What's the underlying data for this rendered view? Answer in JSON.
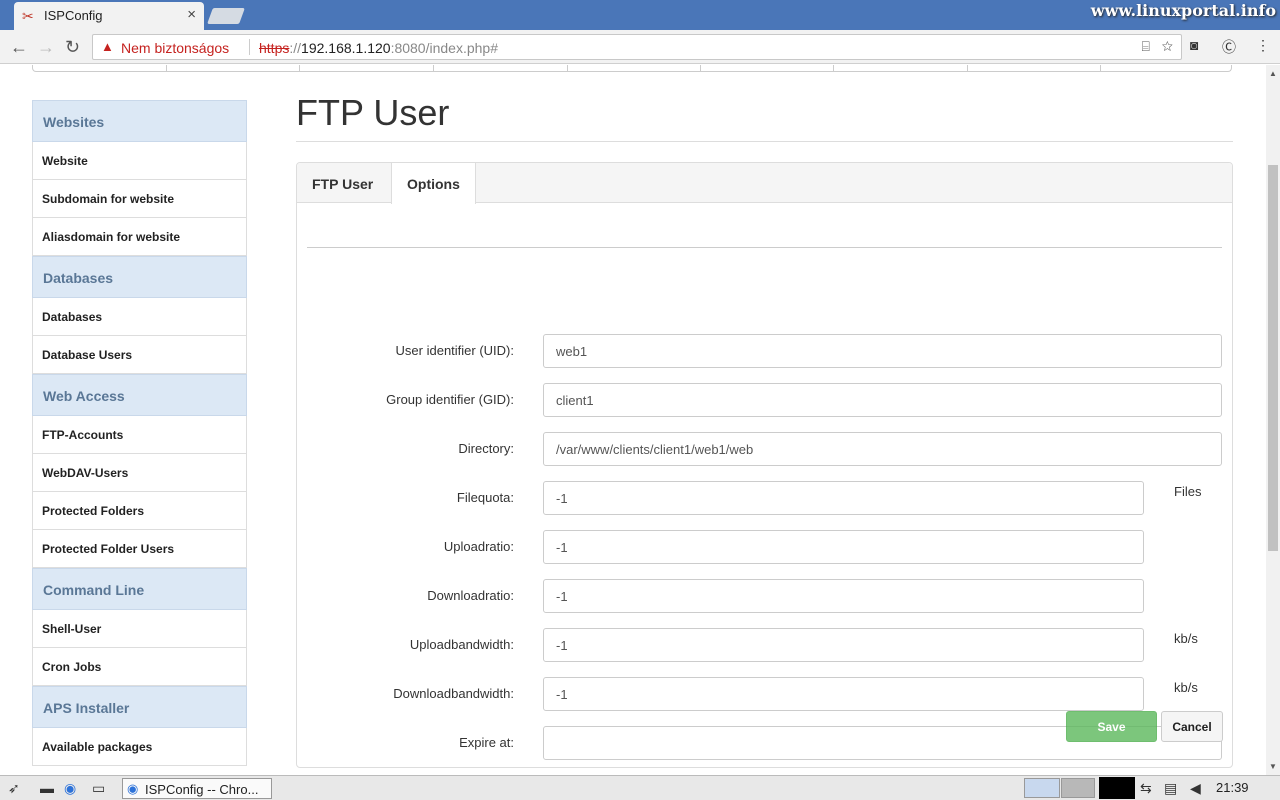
{
  "browser": {
    "tab_title": "ISPConfig",
    "tab_close": "×",
    "watermark": "www.linuxportal.info",
    "security_label": "Nem biztonságos",
    "url_scheme": "https",
    "url_sep": "://",
    "url_host": "192.168.1.120",
    "url_rest": ":8080/index.php#",
    "back_glyph": "←",
    "forward_glyph": "→",
    "reload_glyph": "↻",
    "warn_glyph": "▲",
    "translate_glyph": "⌸",
    "star_glyph": "☆",
    "menu_glyph": "⋮"
  },
  "sidebar": {
    "sections": [
      {
        "title": "Websites",
        "items": [
          "Website",
          "Subdomain for website",
          "Aliasdomain for website"
        ]
      },
      {
        "title": "Databases",
        "items": [
          "Databases",
          "Database Users"
        ]
      },
      {
        "title": "Web Access",
        "items": [
          "FTP-Accounts",
          "WebDAV-Users",
          "Protected Folders",
          "Protected Folder Users"
        ]
      },
      {
        "title": "Command Line",
        "items": [
          "Shell-User",
          "Cron Jobs"
        ]
      },
      {
        "title": "APS Installer",
        "items": [
          "Available packages"
        ]
      }
    ]
  },
  "main": {
    "title": "FTP User",
    "tabs": [
      "FTP User",
      "Options"
    ],
    "active_tab": "Options",
    "fields": {
      "uid": {
        "label": "User identifier (UID):",
        "value": "web1"
      },
      "gid": {
        "label": "Group identifier (GID):",
        "value": "client1"
      },
      "directory": {
        "label": "Directory:",
        "value": "/var/www/clients/client1/web1/web"
      },
      "filequota": {
        "label": "Filequota:",
        "value": "-1",
        "unit": "Files"
      },
      "uploadratio": {
        "label": "Uploadratio:",
        "value": "-1"
      },
      "downloadratio": {
        "label": "Downloadratio:",
        "value": "-1"
      },
      "uploadbandwidth": {
        "label": "Uploadbandwidth:",
        "value": "-1",
        "unit": "kb/s"
      },
      "downloadbandwidth": {
        "label": "Downloadbandwidth:",
        "value": "-1",
        "unit": "kb/s"
      },
      "expire": {
        "label": "Expire at:",
        "value": ""
      }
    },
    "save_label": "Save",
    "cancel_label": "Cancel"
  },
  "taskbar": {
    "window_label": "ISPConfig -- Chro...",
    "clock": "21:39"
  }
}
